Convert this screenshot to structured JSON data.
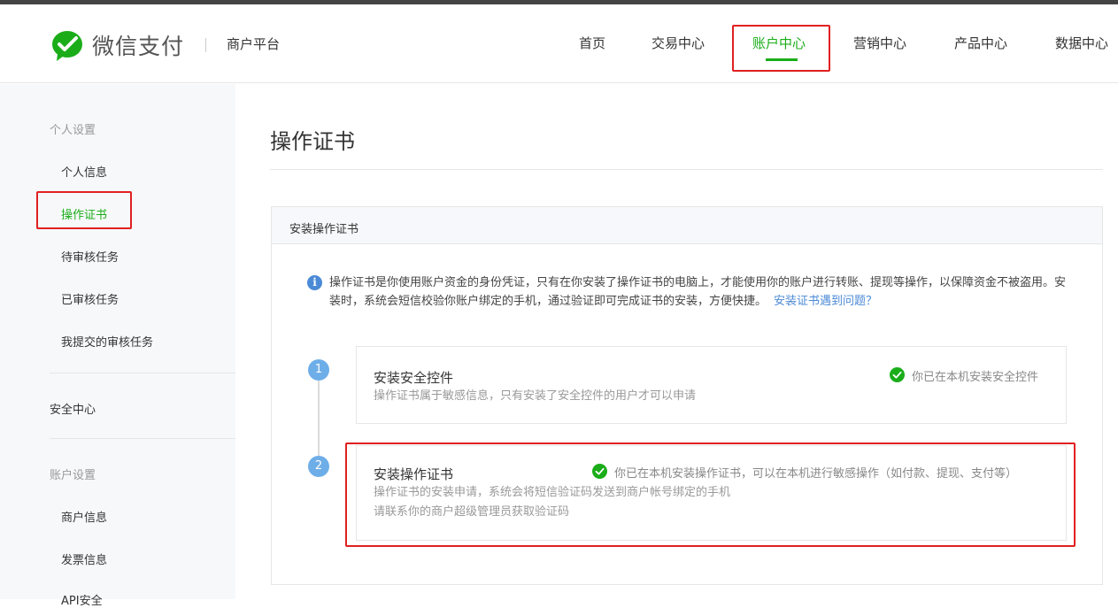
{
  "header": {
    "logo_text": "微信支付",
    "platform": "商户平台",
    "nav": [
      "首页",
      "交易中心",
      "账户中心",
      "营销中心",
      "产品中心",
      "数据中心"
    ]
  },
  "sidebar": {
    "group1": "个人设置",
    "items1": [
      "个人信息",
      "操作证书",
      "待审核任务",
      "已审核任务",
      "我提交的审核任务"
    ],
    "security": "安全中心",
    "group2": "账户设置",
    "items2": [
      "商户信息",
      "发票信息",
      "API安全"
    ]
  },
  "main": {
    "title": "操作证书",
    "panel_title": "安装操作证书",
    "info_icon": "i",
    "info_text": "操作证书是你使用账户资金的身份凭证，只有在你安装了操作证书的电脑上，才能使用你的账户进行转账、提现等操作，以保障资金不被盗用。安装时，系统会短信校验你账户绑定的手机，通过验证即可完成证书的安装，方便快捷。",
    "info_link": "安装证书遇到问题？",
    "steps": [
      {
        "num": "1",
        "title": "安装安全控件",
        "desc1": "操作证书属于敏感信息，只有安装了安全控件的用户才可以申请",
        "status": "你已在本机安装安全控件"
      },
      {
        "num": "2",
        "title": "安装操作证书",
        "desc1": "操作证书的安装申请，系统会将短信验证码发送到商户帐号绑定的手机",
        "desc2": "请联系你的商户超级管理员获取验证码",
        "status": "你已在本机安装操作证书，可以在本机进行敏感操作（如付款、提现、支付等）"
      }
    ]
  },
  "colors": {
    "brand_green": "#1aad19",
    "link_blue": "#4b8ad6",
    "highlight_red": "#e02020"
  }
}
